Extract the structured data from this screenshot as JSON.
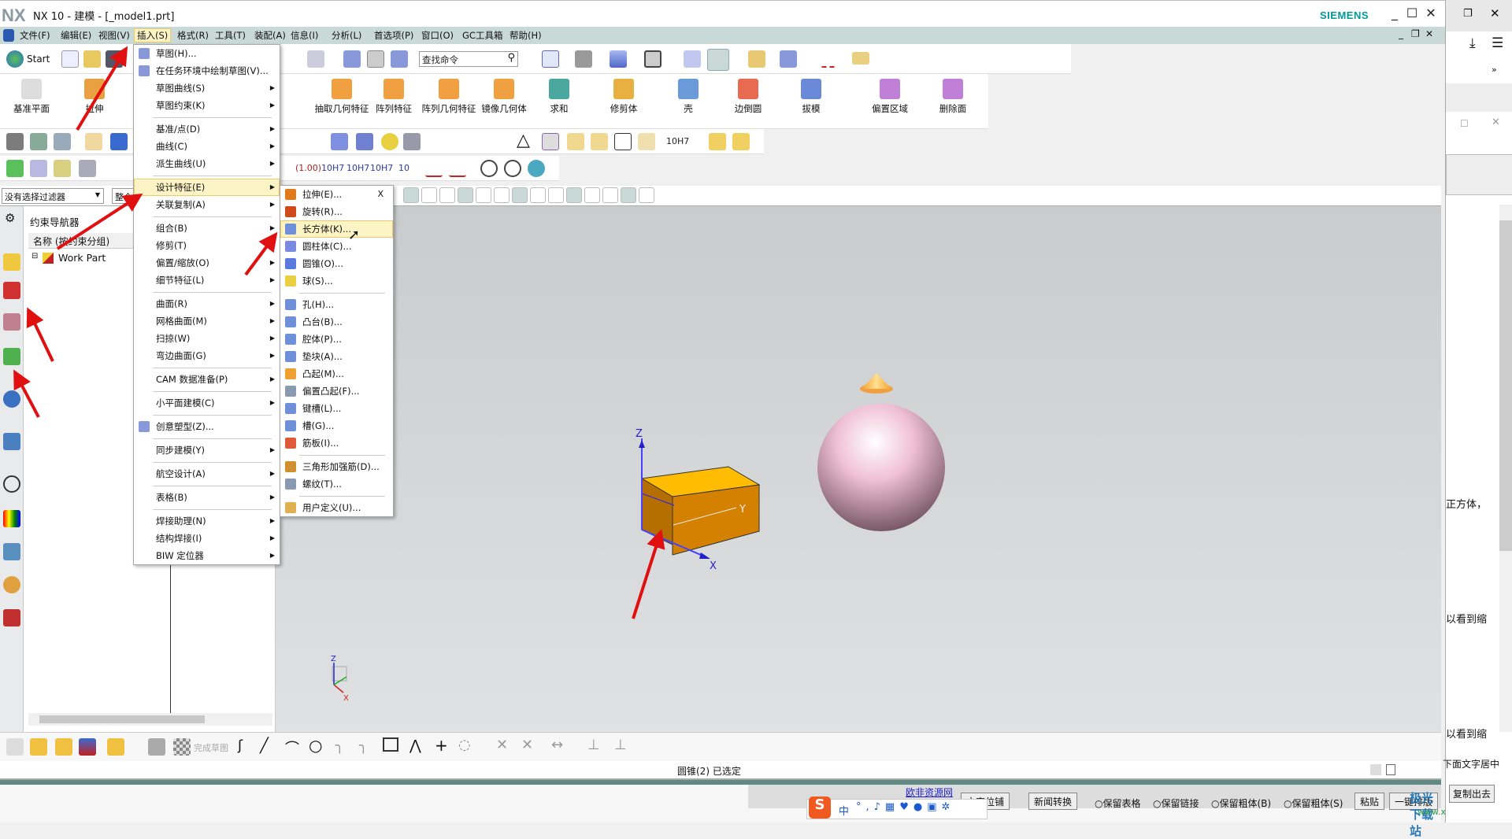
{
  "window": {
    "logo": "NX",
    "title": "NX 10 - 建模 - [_model1.prt]",
    "brand": "SIEMENS",
    "minimize": "_",
    "maximize": "☐",
    "close": "✕",
    "doc_min": "_",
    "doc_restore": "❐",
    "doc_close": "✕"
  },
  "menubar": [
    "文件(F)",
    "编辑(E)",
    "视图(V)",
    "插入(S)",
    "格式(R)",
    "工具(T)",
    "装配(A)",
    "信息(I)",
    "分析(L)",
    "首选项(P)",
    "窗口(O)",
    "GC工具箱",
    "帮助(H)"
  ],
  "quickbar": {
    "start": "Start",
    "search_placeholder": "查找命令"
  },
  "ribbon": [
    "基准平面",
    "拉伸",
    "抽取几何特征",
    "阵列特征",
    "阵列几何特征",
    "镜像几何体",
    "求和",
    "修剪体",
    "壳",
    "边倒圆",
    "拔模",
    "偏置区域",
    "删除面"
  ],
  "dim_labels": [
    "(1.00)",
    "10H7",
    "10H7",
    "10H7",
    "10",
    "10H7"
  ],
  "selection": {
    "filter": "没有选择过滤器",
    "scope": "整个"
  },
  "navigator": {
    "title": "约束导航器",
    "column": "名称 (按约束分组)",
    "root": "Work Part"
  },
  "insert_menu": [
    {
      "label": "草图(H)...",
      "icon": "sketch-icon"
    },
    {
      "label": "在任务环境中绘制草图(V)...",
      "icon": "sketch-task-icon"
    },
    {
      "label": "草图曲线(S)",
      "sub": true
    },
    {
      "label": "草图约束(K)",
      "sub": true
    },
    {
      "sep": true
    },
    {
      "label": "基准/点(D)",
      "sub": true
    },
    {
      "label": "曲线(C)",
      "sub": true
    },
    {
      "label": "派生曲线(U)",
      "sub": true
    },
    {
      "sep": true
    },
    {
      "label": "设计特征(E)",
      "sub": true,
      "hl": true
    },
    {
      "label": "关联复制(A)",
      "sub": true
    },
    {
      "sep": true
    },
    {
      "label": "组合(B)",
      "sub": true
    },
    {
      "label": "修剪(T)",
      "sub": true
    },
    {
      "label": "偏置/缩放(O)",
      "sub": true
    },
    {
      "label": "细节特征(L)",
      "sub": true
    },
    {
      "sep": true
    },
    {
      "label": "曲面(R)",
      "sub": true
    },
    {
      "label": "网格曲面(M)",
      "sub": true
    },
    {
      "label": "扫掠(W)",
      "sub": true
    },
    {
      "label": "弯边曲面(G)",
      "sub": true
    },
    {
      "sep": true
    },
    {
      "label": "CAM 数据准备(P)",
      "sub": true
    },
    {
      "sep": true
    },
    {
      "label": "小平面建模(C)",
      "sub": true
    },
    {
      "sep": true
    },
    {
      "label": "创意塑型(Z)...",
      "icon": "realize-shape-icon"
    },
    {
      "sep": true
    },
    {
      "label": "同步建模(Y)",
      "sub": true
    },
    {
      "sep": true
    },
    {
      "label": "航空设计(A)",
      "sub": true
    },
    {
      "sep": true
    },
    {
      "label": "表格(B)",
      "sub": true
    },
    {
      "sep": true
    },
    {
      "label": "焊接助理(N)",
      "sub": true
    },
    {
      "label": "结构焊接(I)",
      "sub": true
    },
    {
      "label": "BIW 定位器",
      "sub": true
    }
  ],
  "design_feature_menu": [
    {
      "label": "拉伸(E)...",
      "icon": "extrude-icon",
      "color": "#e07a1a",
      "shortcut": "X"
    },
    {
      "label": "旋转(R)...",
      "icon": "revolve-icon",
      "color": "#d04a1a"
    },
    {
      "label": "长方体(K)...",
      "icon": "block-icon",
      "color": "#6f8fd8",
      "hl": true
    },
    {
      "label": "圆柱体(C)...",
      "icon": "cylinder-icon",
      "color": "#7a8ae0"
    },
    {
      "label": "圆锥(O)...",
      "icon": "cone-icon",
      "color": "#5a7ae0"
    },
    {
      "label": "球(S)...",
      "icon": "sphere-icon",
      "color": "#e8d040"
    },
    {
      "sep": true
    },
    {
      "label": "孔(H)...",
      "icon": "hole-icon",
      "color": "#6f8fd8"
    },
    {
      "label": "凸台(B)...",
      "icon": "boss-icon",
      "color": "#6f8fd8"
    },
    {
      "label": "腔体(P)...",
      "icon": "pocket-icon",
      "color": "#6f8fd8"
    },
    {
      "label": "垫块(A)...",
      "icon": "pad-icon",
      "color": "#6f8fd8"
    },
    {
      "label": "凸起(M)...",
      "icon": "emboss-icon",
      "color": "#f0a030"
    },
    {
      "label": "偏置凸起(F)...",
      "icon": "offset-emboss-icon",
      "color": "#8a9ab0"
    },
    {
      "label": "键槽(L)...",
      "icon": "slot-icon",
      "color": "#6f8fd8"
    },
    {
      "label": "槽(G)...",
      "icon": "groove-icon",
      "color": "#6f8fd8"
    },
    {
      "label": "筋板(I)...",
      "icon": "rib-icon",
      "color": "#e05a3a"
    },
    {
      "sep": true
    },
    {
      "label": "三角形加强筋(D)...",
      "icon": "dart-icon",
      "color": "#d09030"
    },
    {
      "label": "螺纹(T)...",
      "icon": "thread-icon",
      "color": "#8a9ab0"
    },
    {
      "sep": true
    },
    {
      "label": "用户定义(U)...",
      "icon": "user-defined-icon",
      "color": "#e0b050"
    }
  ],
  "viewport": {
    "axis_x": "X",
    "axis_y": "Y",
    "axis_z": "Z",
    "cube_color": "#d98200",
    "sphere_color": "#e8b8cc",
    "cone_color": "#f5b040"
  },
  "sketchbar": {
    "finish_sketch": "完成草图"
  },
  "status": {
    "message": "圆锥(2) 已选定"
  },
  "right_panel": {
    "text1": "正方体，",
    "text2": "以看到缩",
    "text3": "以看到缩",
    "text4": "下面文字居中"
  },
  "bottom": {
    "link": "欧非资源网",
    "btn1": "文字位铺",
    "btn2": "新闻转换",
    "radios": [
      "保留表格",
      "保留链接",
      "保留粗体(B)",
      "保留粗体(S)"
    ],
    "btn3": "粘贴",
    "btn4": "一键排版",
    "btn5": "复制出去",
    "ime": "中",
    "watermark": "极光下载站",
    "watermark_url": "www.xz7.com"
  },
  "colors": {
    "menubar": "#c8d9d8",
    "highlight": "#fdf4c6",
    "annotation_arrow": "#e01010"
  }
}
